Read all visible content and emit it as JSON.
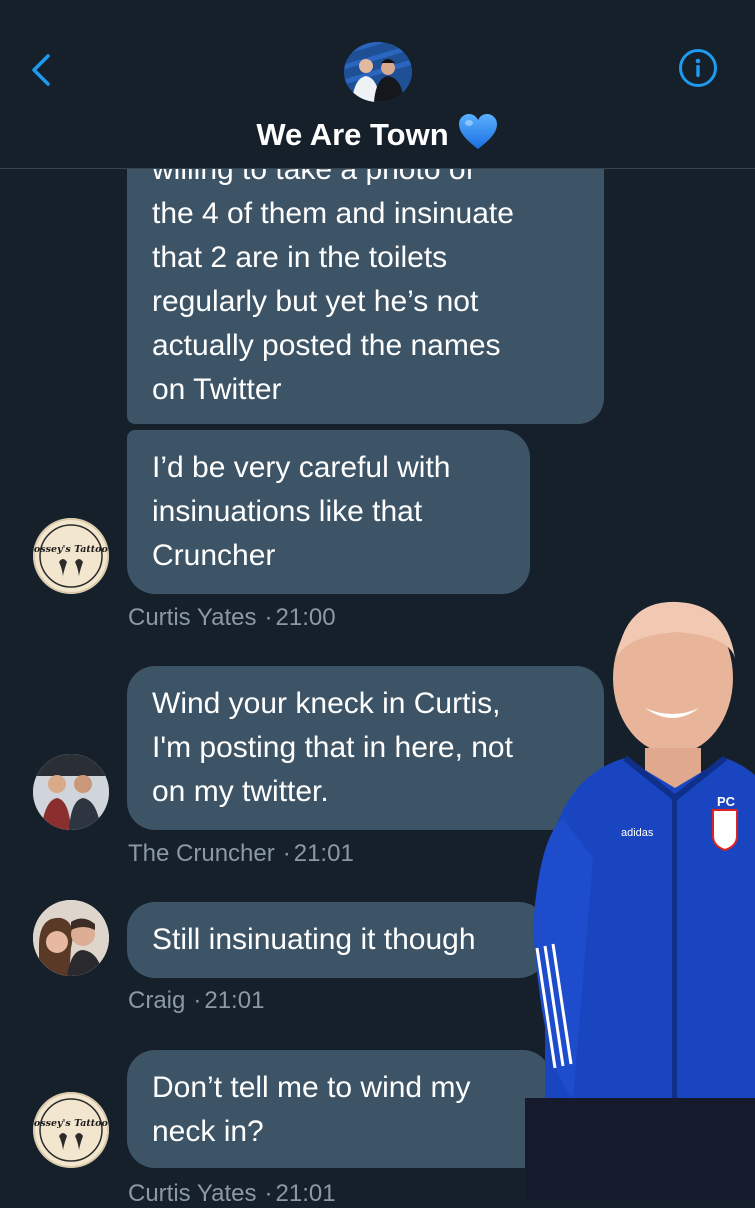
{
  "header": {
    "title": "We Are Town",
    "heart_icon": "blue-heart-emoji",
    "accent_color": "#1d9bf0"
  },
  "messages": [
    {
      "lines": [
        "willing to take a photo of",
        "the 4 of them and insinuate",
        "that 2 are in the toilets",
        "regularly but yet he’s not",
        "actually posted the names",
        "on Twitter"
      ]
    },
    {
      "lines": [
        "I’d be very careful with",
        "insinuations like that",
        "Cruncher"
      ],
      "sender": "Curtis Yates",
      "time": "21:00"
    },
    {
      "lines": [
        "Wind your kneck in Curtis,",
        "I'm posting that in here, not",
        "on my twitter."
      ],
      "sender": "The Cruncher",
      "time": "21:01"
    },
    {
      "lines": [
        "Still insinuating it though"
      ],
      "sender": "Craig",
      "time": "21:01"
    },
    {
      "lines": [
        "Don’t tell me to wind my",
        "neck in?"
      ],
      "sender": "Curtis Yates",
      "time": "21:01"
    }
  ],
  "meta_separator": "·",
  "logo_text": "Bossey's Tattoo's",
  "badge_text": "PC"
}
